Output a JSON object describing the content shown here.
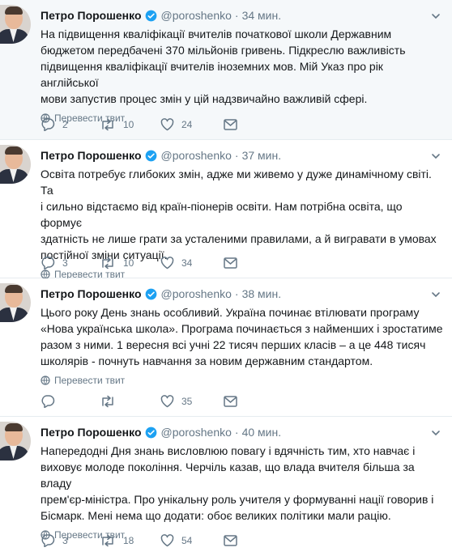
{
  "author": {
    "name": "Петро Порошенко",
    "handle": "@poroshenko"
  },
  "labels": {
    "translate": "Перевести твит",
    "separator": "·"
  },
  "colors": {
    "verified_badge": "#1da1f2",
    "icon_gray": "#657786",
    "highlight_background": "#f5f8fa"
  },
  "tweets": [
    {
      "time": "34 мин.",
      "text": "На підвищення кваліфікації вчителів початкової школи Державним\nбюджетом передбачені 370 мільйонів гривень. Підкреслю важливість\nпідвищення кваліфікації вчителів іноземних мов. Мій Указ про рік англійської\nмови запустив процес змін у цій надзвичайно важливій сфері.",
      "replies": "2",
      "retweets": "10",
      "likes": "24"
    },
    {
      "time": "37 мин.",
      "text": "Освіта  потребує глибоких змін, адже ми живемо у дуже динамічному світі. Та\nі сильно відстаємо від країн-піонерів освіти. Нам потрібна освіта, що формує\nздатність не лише грати за усталеними правилами, а й вигравати в умовах\nпостійної зміни ситуації.",
      "replies": "3",
      "retweets": "10",
      "likes": "34"
    },
    {
      "time": "38 мин.",
      "text": "Цього року День знань особливий. Україна починає втілювати програму\n«Нова українська школа». Програма починається з найменших і зростатиме\nразом з ними.   1 вересня всі учні 22 тисяч перших класів – а це 448 тисяч\nшколярів - почнуть навчання за новим державним стандартом.",
      "replies": "",
      "retweets": "",
      "likes": "35"
    },
    {
      "time": "40 мин.",
      "text": "Напередодні Дня знань висловлюю повагу і вдячність тим, хто навчає і\nвиховує молоде покоління. Черчіль казав, що влада вчителя більша за владу\nпрем'єр-міністра. Про унікальну роль учителя у формуванні нації говорив і\nБісмарк. Мені нема що додати: обоє великих політики мали рацію.",
      "replies": "3",
      "retweets": "18",
      "likes": "54"
    }
  ]
}
